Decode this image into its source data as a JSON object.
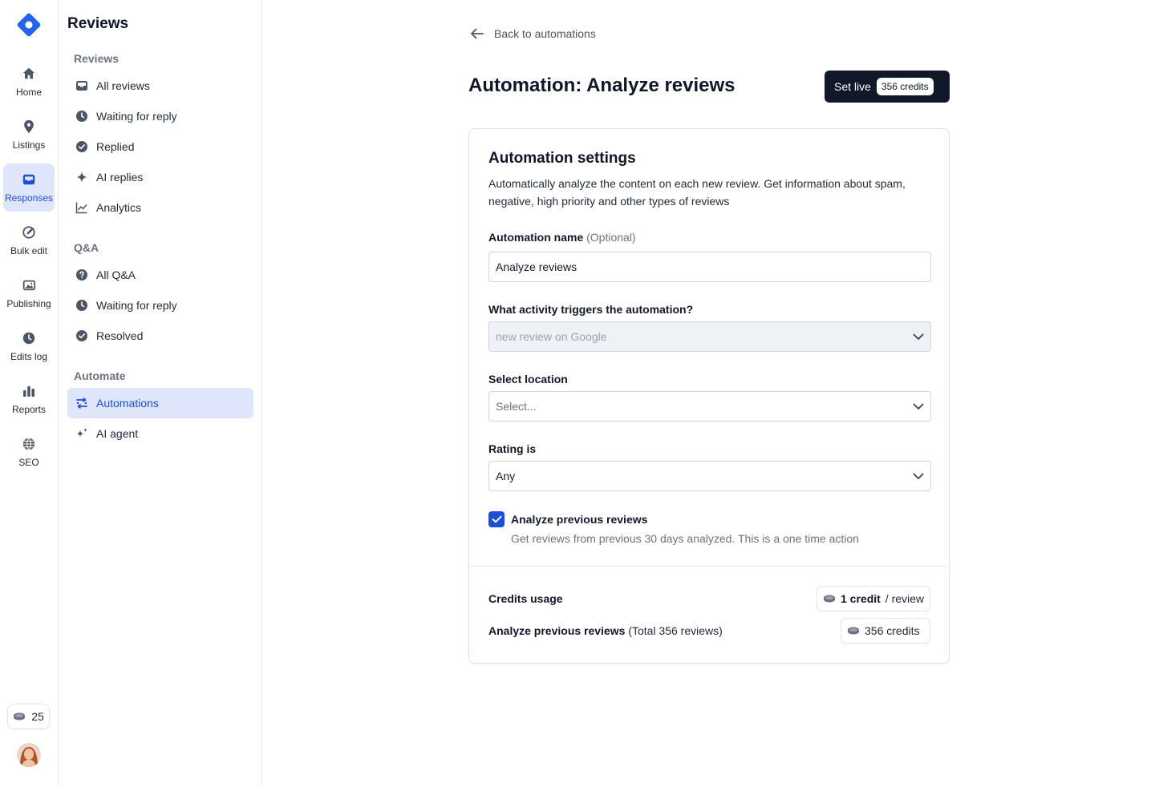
{
  "rail": {
    "items": [
      {
        "label": "Home",
        "icon": "home-icon"
      },
      {
        "label": "Listings",
        "icon": "map-pin-icon"
      },
      {
        "label": "Responses",
        "icon": "inbox-icon",
        "active": true
      },
      {
        "label": "Bulk edit",
        "icon": "bulk-edit-icon"
      },
      {
        "label": "Publishing",
        "icon": "images-icon"
      },
      {
        "label": "Edits log",
        "icon": "clock-icon"
      },
      {
        "label": "Reports",
        "icon": "bar-chart-icon"
      },
      {
        "label": "SEO",
        "icon": "globe-icon"
      }
    ],
    "credits": "25"
  },
  "sidebar": {
    "title": "Reviews",
    "sections": [
      {
        "title": "Reviews",
        "items": [
          {
            "label": "All reviews",
            "icon": "inbox-icon"
          },
          {
            "label": "Waiting for reply",
            "icon": "clock-icon"
          },
          {
            "label": "Replied",
            "icon": "check-circle-icon"
          },
          {
            "label": "AI replies",
            "icon": "sparkle-icon"
          },
          {
            "label": "Analytics",
            "icon": "line-chart-icon"
          }
        ]
      },
      {
        "title": "Q&A",
        "items": [
          {
            "label": "All Q&A",
            "icon": "question-circle-icon"
          },
          {
            "label": "Waiting for reply",
            "icon": "clock-icon"
          },
          {
            "label": "Resolved",
            "icon": "check-circle-icon"
          }
        ]
      },
      {
        "title": "Automate",
        "items": [
          {
            "label": "Automations",
            "icon": "automations-icon",
            "active": true
          },
          {
            "label": "AI agent",
            "icon": "sparkles-icon"
          }
        ]
      }
    ]
  },
  "main": {
    "back_label": "Back to automations",
    "title": "Automation: Analyze reviews",
    "set_live_label": "Set live",
    "set_live_credits": "356 credits",
    "card": {
      "title": "Automation settings",
      "description": "Automatically analyze the content on each new review. Get information about spam, negative, high priority and other types of reviews",
      "name_label": "Automation name",
      "name_optional": "(Optional)",
      "name_value": "Analyze reviews",
      "trigger_label": "What activity triggers the automation?",
      "trigger_value": "new review on Google",
      "location_label": "Select location",
      "location_placeholder": "Select...",
      "rating_label": "Rating is",
      "rating_value": "Any",
      "checkbox_checked": true,
      "checkbox_label": "Analyze previous reviews",
      "checkbox_help": "Get reviews from previous 30 days analyzed. This is a one time action",
      "credits_usage_label": "Credits usage",
      "per_review_strong": "1 credit",
      "per_review_rest": "/ review",
      "previous_label": "Analyze previous reviews",
      "previous_total": "(Total 356 reviews)",
      "previous_credits": "356 credits"
    }
  },
  "colors": {
    "accent": "#1d4ed8",
    "accent_bg": "#dfe6fb",
    "dark_button": "#111827",
    "logo": "#2563eb"
  }
}
